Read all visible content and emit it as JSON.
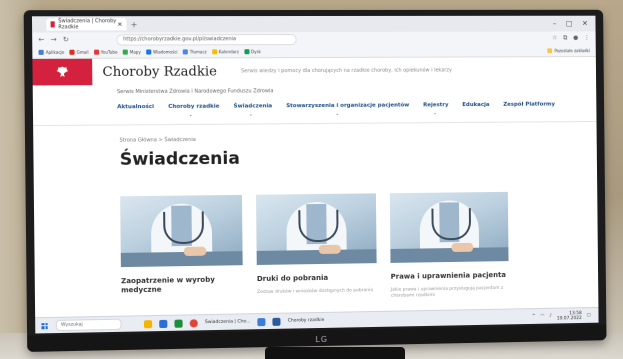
{
  "browser": {
    "tab_title": "Świadczenia | Choroby Rzadkie",
    "new_tab": "+",
    "url": "https://chorobyrzadkie.gov.pl/pl/swiadczenia",
    "window_controls": [
      "–",
      "□",
      "✕"
    ],
    "bookmarks": [
      "Aplikacje",
      "Gmail",
      "YouTube",
      "Mapy",
      "Wiadomości",
      "Tłumacz",
      "Kalendarz",
      "Dysk",
      "Pozostałe zakładki"
    ]
  },
  "site": {
    "title": "Choroby Rzadkie",
    "tagline": "Serwis wiedzy i pomocy dla chorujących na rzadkie choroby, ich opiekunów i lekarzy",
    "ministry": "Serwis Ministerstwa Zdrowia i Narodowego Funduszu Zdrowia",
    "brand_color": "#d4213d",
    "nav": [
      "Aktualności",
      "Choroby rzadkie",
      "Świadczenia",
      "Stowarzyszenia i organizacje pacjentów",
      "Rejestry",
      "Edukacja",
      "Zespół Platformy"
    ]
  },
  "breadcrumb": {
    "home": "Strona Główna",
    "sep": ">",
    "current": "Świadczenia"
  },
  "page_title": "Świadczenia",
  "cards": [
    {
      "title": "Zaopatrzenie w wyroby medyczne",
      "text": ""
    },
    {
      "title": "Druki do pobrania",
      "text": "Zestaw druków i wniosków dostępnych do pobrania"
    },
    {
      "title": "Prawa i uprawnienia pacjenta",
      "text": "Jakie prawa i uprawnienia przysługują pacjentom z chorobami rzadkimi"
    }
  ],
  "taskbar": {
    "search_placeholder": "Wyszukaj",
    "active_window": "Świadczenia | Cho...",
    "app_label": "Choroby rzadkie",
    "time": "13:58",
    "date": "19.07.2022"
  },
  "monitor_brand": "LG"
}
